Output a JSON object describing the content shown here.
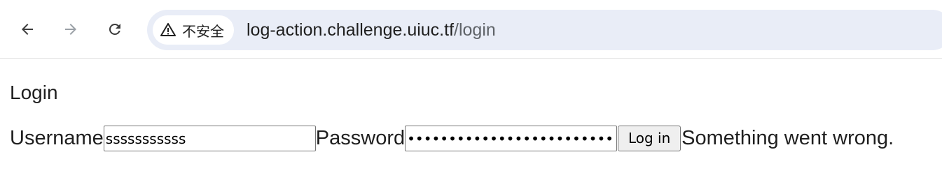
{
  "browser": {
    "security_chip_label": "不安全",
    "url_host": "log-action.challenge.uiuc.tf",
    "url_path": "/login"
  },
  "page": {
    "title": "Login",
    "username_label": "Username",
    "username_value": "sssssssssss",
    "password_label": "Password",
    "password_value": "sssssssssssssssssssssssssss",
    "login_button_label": "Log in",
    "status_message": "Something went wrong."
  }
}
